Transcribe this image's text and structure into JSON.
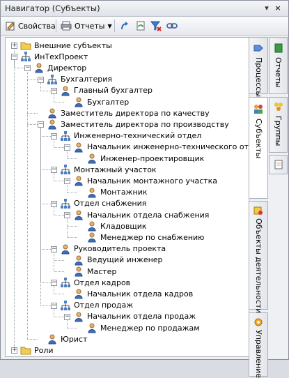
{
  "window": {
    "title": "Навигатор (Субъекты)"
  },
  "toolbar": {
    "properties": "Свойства",
    "reports": "Отчеты"
  },
  "tree": [
    {
      "label": "Внешние субъекты",
      "icon": "folder-icon"
    },
    {
      "label": "ИнТехПроект",
      "icon": "org-chart-icon"
    },
    {
      "label": "Директор",
      "icon": "person-icon"
    },
    {
      "label": "Бухгалтерия",
      "icon": "org-chart-icon"
    },
    {
      "label": "Главный бухгалтер",
      "icon": "person-icon"
    },
    {
      "label": "Бухгалтер",
      "icon": "person-icon"
    },
    {
      "label": "Заместитель директора по качеству",
      "icon": "person-icon"
    },
    {
      "label": "Заместитель директора по производству",
      "icon": "person-icon"
    },
    {
      "label": "Инженерно-технический отдел",
      "icon": "org-chart-icon"
    },
    {
      "label": "Начальник инженерно-технического отдела",
      "icon": "person-icon"
    },
    {
      "label": "Инженер-проектировщик",
      "icon": "person-icon"
    },
    {
      "label": "Монтажный участок",
      "icon": "org-chart-icon"
    },
    {
      "label": "Начальник монтажного участка",
      "icon": "person-icon"
    },
    {
      "label": "Монтажник",
      "icon": "person-icon"
    },
    {
      "label": "Отдел снабжения",
      "icon": "org-chart-icon"
    },
    {
      "label": "Начальник отдела снабжения",
      "icon": "person-icon"
    },
    {
      "label": "Кладовщик",
      "icon": "person-icon"
    },
    {
      "label": "Менеджер по снабжению",
      "icon": "person-icon"
    },
    {
      "label": "Руководитель проекта",
      "icon": "person-icon"
    },
    {
      "label": "Ведущий инженер",
      "icon": "person-icon"
    },
    {
      "label": "Мастер",
      "icon": "person-icon"
    },
    {
      "label": "Отдел кадров",
      "icon": "org-chart-icon"
    },
    {
      "label": "Начальник отдела кадров",
      "icon": "person-icon"
    },
    {
      "label": "Отдел продаж",
      "icon": "org-chart-icon"
    },
    {
      "label": "Начальник отдела продаж",
      "icon": "person-icon"
    },
    {
      "label": "Менеджер по продажам",
      "icon": "person-icon"
    },
    {
      "label": "Юрист",
      "icon": "person-icon"
    },
    {
      "label": "Роли",
      "icon": "folder-icon"
    }
  ],
  "side_tabs": {
    "processes": "Процессы",
    "reports": "Отчеты",
    "subjects": "Субъекты",
    "groups": "Группы",
    "activity_objects": "Объекты деятельности",
    "management": "Управление"
  }
}
